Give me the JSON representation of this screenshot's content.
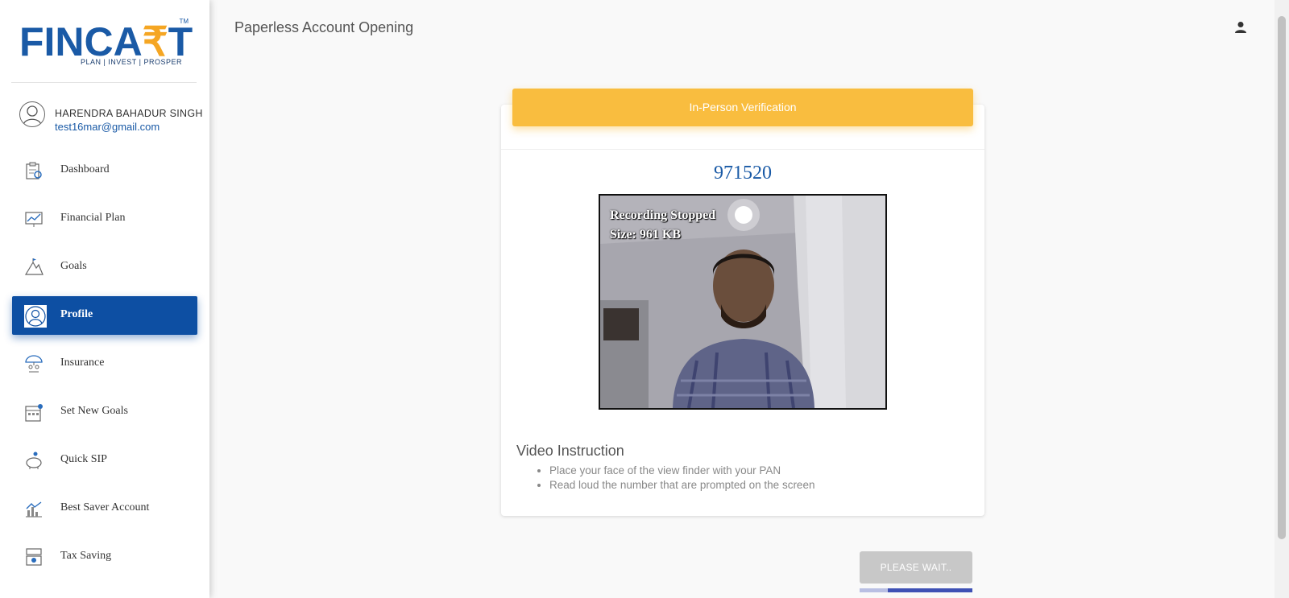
{
  "sidebar": {
    "logo": {
      "text_before": "FINCA",
      "text_after": "T",
      "tagline": "PLAN | INVEST | PROSPER",
      "tm": "TM"
    },
    "user": {
      "name": "HARENDRA BAHADUR SINGH",
      "email": "test16mar@gmail.com"
    },
    "items": [
      {
        "label": "Dashboard",
        "icon": "dashboard-icon",
        "active": false
      },
      {
        "label": "Financial Plan",
        "icon": "financial-plan-icon",
        "active": false
      },
      {
        "label": "Goals",
        "icon": "goals-icon",
        "active": false
      },
      {
        "label": "Profile",
        "icon": "profile-icon",
        "active": true
      },
      {
        "label": "Insurance",
        "icon": "insurance-icon",
        "active": false
      },
      {
        "label": "Set New Goals",
        "icon": "set-new-goals-icon",
        "active": false
      },
      {
        "label": "Quick SIP",
        "icon": "quick-sip-icon",
        "active": false
      },
      {
        "label": "Best Saver Account",
        "icon": "best-saver-account-icon",
        "active": false
      },
      {
        "label": "Tax Saving",
        "icon": "tax-saving-icon",
        "active": false
      }
    ]
  },
  "header": {
    "title": "Paperless Account Opening",
    "account_icon": "account-icon"
  },
  "verification": {
    "banner": "In-Person Verification",
    "code": "971520",
    "video": {
      "status": "Recording Stopped",
      "size": "Size: 961 KB"
    },
    "instructions": {
      "title": "Video Instruction",
      "items": [
        "Place your face of the view finder with your PAN",
        "Read loud the number that are prompted on the screen"
      ]
    }
  },
  "actions": {
    "wait_label": "PLEASE WAIT..",
    "progress": 0.75
  },
  "colors": {
    "brand": "#1a5aa6",
    "accent": "#f9bd3f",
    "active_nav": "#0d4fa3",
    "progress": "#3f51b5"
  }
}
